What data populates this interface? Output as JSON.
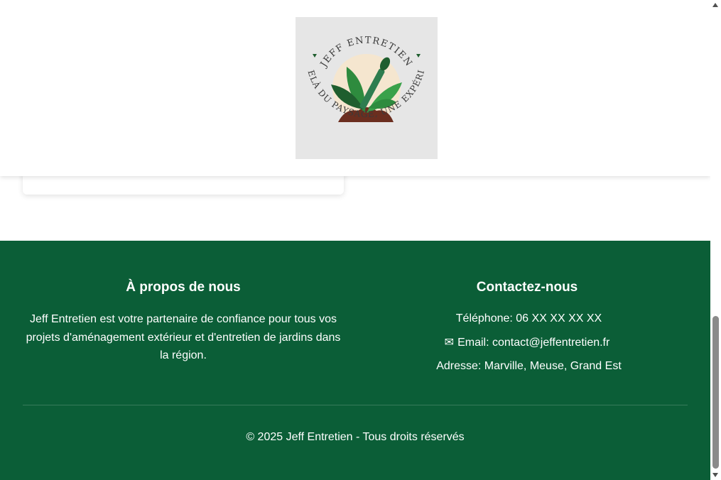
{
  "header": {
    "logo": {
      "top_text": "JEFF ENTRETIEN",
      "bottom_text": "AU DELÀ DU PAYSAGE, UNE EXPÉRIENCE",
      "colors": {
        "leaf": "#2e8b3e",
        "dark_leaf": "#1f5e2e",
        "soil": "#6b2e1f",
        "text": "#3a3a3a",
        "background": "#e6e6e6",
        "circle": "#f5e6cf"
      }
    }
  },
  "footer": {
    "about": {
      "title": "À propos de nous",
      "text": "Jeff Entretien est votre partenaire de confiance pour tous vos projets d'aménagement extérieur et d'entretien de jardins dans la région."
    },
    "contact": {
      "title": "Contactez-nous",
      "phone": {
        "icon": "phone-icon",
        "glyph": "",
        "text": "Téléphone: 06 XX XX XX XX"
      },
      "email": {
        "icon": "envelope-icon",
        "glyph": "✉",
        "text": "Email: contact@jeffentretien.fr"
      },
      "address": {
        "icon": "location-pin-icon",
        "glyph": "",
        "text": "Adresse: Marville, Meuse, Grand Est"
      }
    },
    "copyright": "© 2025 Jeff Entretien - Tous droits réservés",
    "colors": {
      "background": "#0b5e37",
      "text": "#ffffff"
    }
  }
}
